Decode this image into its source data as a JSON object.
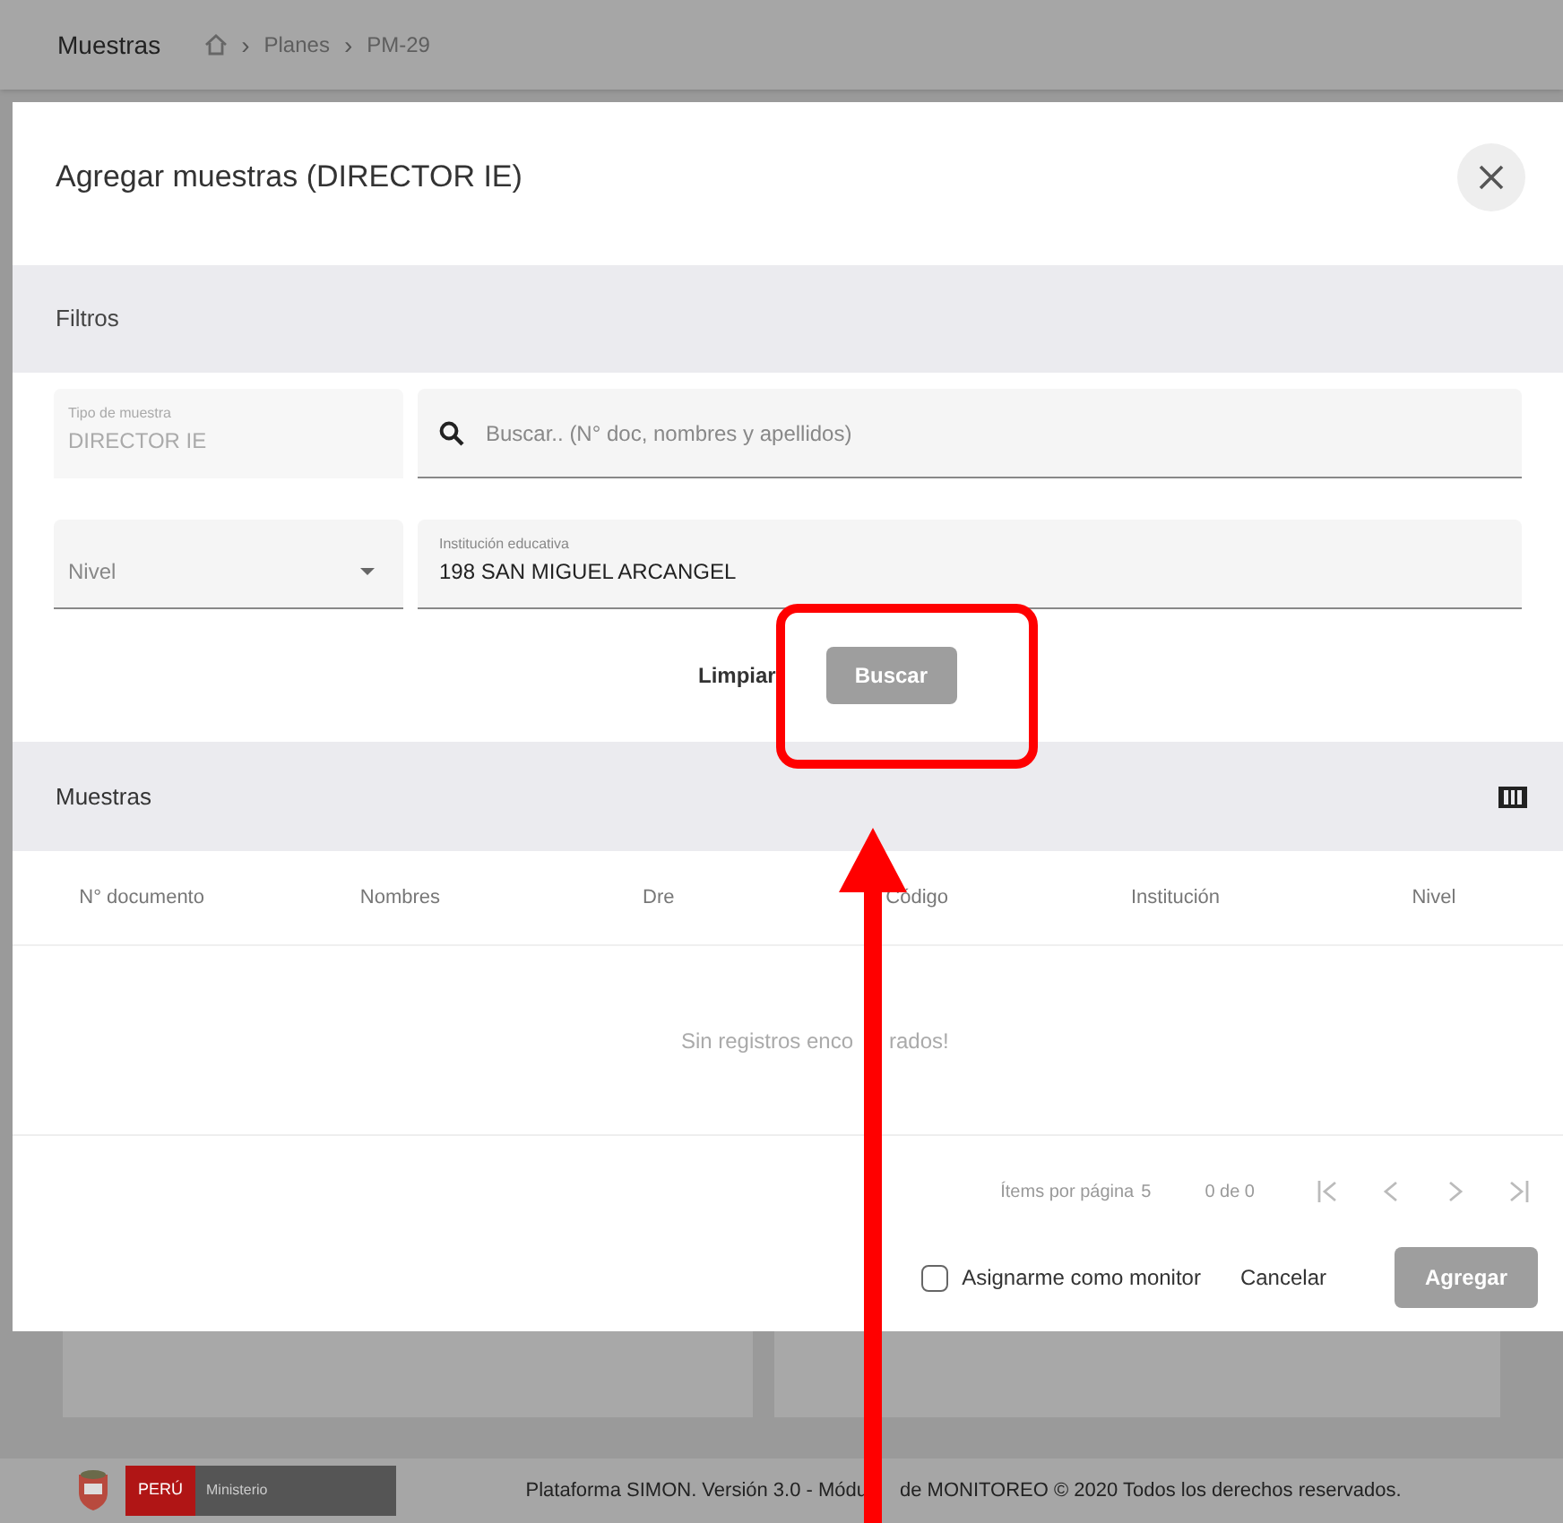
{
  "page": {
    "title": "Muestras",
    "breadcrumb": [
      "Planes",
      "PM-29"
    ],
    "breadcrumb_separator": "›"
  },
  "dialog": {
    "title": "Agregar muestras (DIRECTOR IE)",
    "filters": {
      "title": "Filtros",
      "type_field": {
        "label": "Tipo de muestra",
        "value": "DIRECTOR IE",
        "disabled": true
      },
      "search_field": {
        "placeholder": "Buscar.. (N° doc, nombres y apellidos)"
      },
      "level_select": {
        "placeholder": "Nivel"
      },
      "school_field": {
        "label": "Institución educativa",
        "value": "198 SAN MIGUEL ARCANGEL"
      },
      "buttons": [
        {
          "label": "Limpiar",
          "kind": "text"
        },
        {
          "label": "Buscar",
          "kind": "filled",
          "disabled": true
        }
      ]
    },
    "table": {
      "title": "Muestras",
      "columns": [
        "N° documento",
        "Nombres",
        "Dre",
        "Código",
        "Institución",
        "Nivel"
      ],
      "empty_message": [
        "Sin registros enco",
        "rados!"
      ]
    },
    "paginator": {
      "items_per_page_label": "Ítems por página",
      "items_per_page": "5",
      "range": "0 de 0"
    },
    "footer": {
      "assign_checkbox": {
        "label": "Asignarme como monitor",
        "checked": false
      },
      "cancel": "Cancelar",
      "submit": {
        "label": "Agregar",
        "disabled": true
      }
    }
  },
  "page_footer": {
    "logo_country": "PERÚ",
    "logo_ministry": "Ministerio",
    "text": [
      "Plataforma SIMON. Versión 3.0 - Módu",
      "de MONITOREO © 2020 Todos los derechos reservados."
    ]
  }
}
